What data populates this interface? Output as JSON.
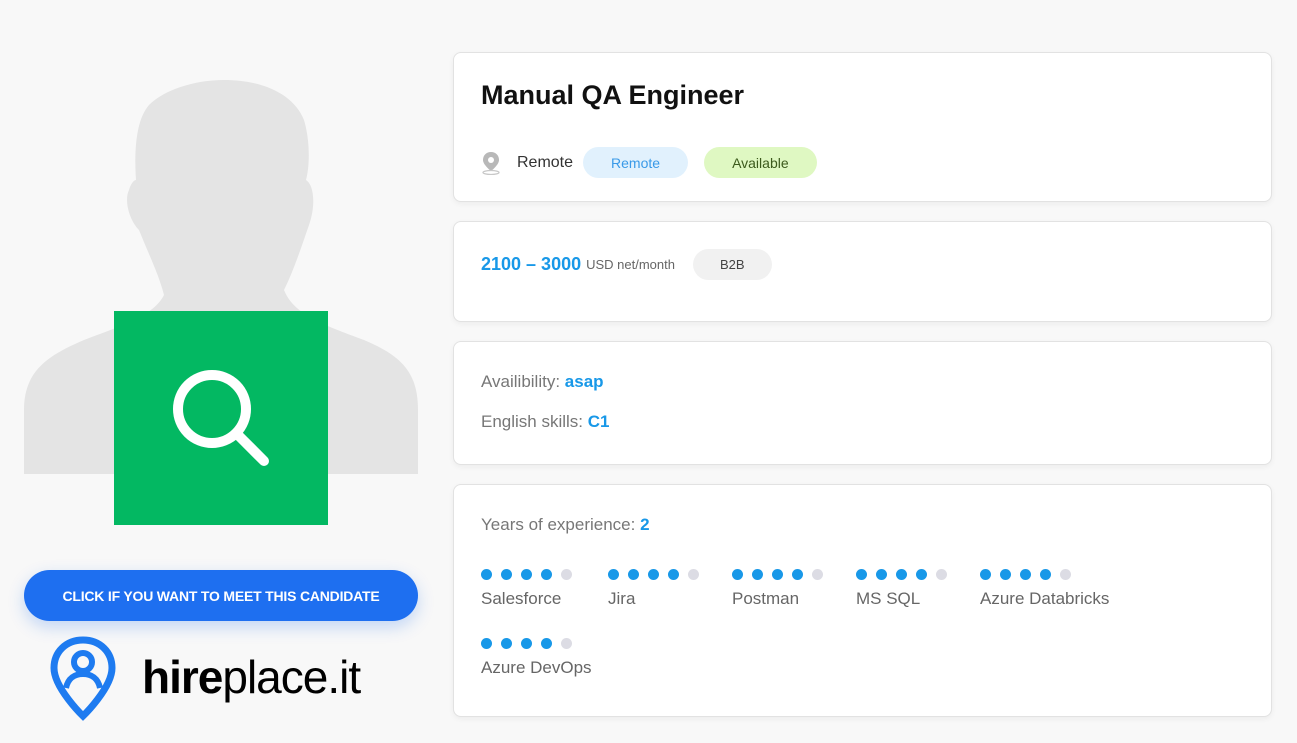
{
  "profile": {
    "cta_label": "CLICK IF YOU WANT TO MEET THIS CANDIDATE",
    "logo_bold": "hire",
    "logo_light": "place.it"
  },
  "job": {
    "title": "Manual QA Engineer",
    "location": "Remote",
    "badges": {
      "work_mode": "Remote",
      "status": "Available"
    }
  },
  "salary": {
    "range": "2100 – 3000",
    "unit": "USD net/month",
    "contract": "B2B"
  },
  "details": {
    "availability_label": "Availibility:",
    "availability_value": "asap",
    "english_label": "English skills:",
    "english_value": "C1"
  },
  "experience": {
    "label": "Years of experience:",
    "value": "2",
    "skills": [
      {
        "name": "Salesforce",
        "level": 4,
        "max": 5
      },
      {
        "name": "Jira",
        "level": 4,
        "max": 5
      },
      {
        "name": "Postman",
        "level": 4,
        "max": 5
      },
      {
        "name": "MS SQL",
        "level": 4,
        "max": 5
      },
      {
        "name": "Azure Databricks",
        "level": 4,
        "max": 5
      },
      {
        "name": "Azure DevOps",
        "level": 4,
        "max": 5
      }
    ]
  },
  "colors": {
    "accent_blue": "#1898e8",
    "cta_blue": "#1e6ff0",
    "search_green": "#03b862"
  }
}
